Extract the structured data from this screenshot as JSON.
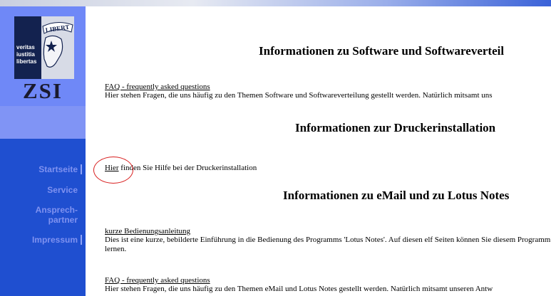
{
  "logo": {
    "banner_text": "LIBERT",
    "motto": [
      "veritas",
      "iustitia",
      "libertas"
    ],
    "abbr": "ZSI"
  },
  "nav": {
    "items": [
      {
        "label": "Startseite"
      },
      {
        "label": "Service"
      },
      {
        "label": "Ansprech-\npartner"
      },
      {
        "label": "Impressum"
      }
    ]
  },
  "sections": {
    "software": {
      "heading": "Informationen zu Software und Softwareverteil",
      "faq_link": "FAQ - frequently asked questions",
      "faq_desc": "Hier stehen Fragen, die uns häufig zu den Themen Software und Softwareverteilung gestellt werden. Natürlich mitsamt uns"
    },
    "drucker": {
      "heading": "Informationen zur Druckerinstallation",
      "link": "Hier",
      "text": " finden Sie Hilfe bei der Druckerinstallation"
    },
    "email": {
      "heading": "Informationen zu eMail und zu Lotus Notes",
      "manual_link": "kurze Bedienungsanleitung",
      "manual_desc": "Dies ist eine kurze, bebilderte Einführung in die Bedienung des Programms 'Lotus Notes'. Auf diesen elf Seiten können Sie diesem Programm lernen.",
      "faq_link": "FAQ - frequently asked questions",
      "faq_desc": "Hier stehen Fragen, die uns häufig zu den Themen eMail und Lotus Notes gestellt werden. Natürlich mitsamt unseren Antw"
    }
  },
  "colors": {
    "sidebar": "#1f4fd0",
    "logo_block": "#6f88f7",
    "nav_text": "#7f92f0",
    "annotation": "#d81e1e"
  }
}
